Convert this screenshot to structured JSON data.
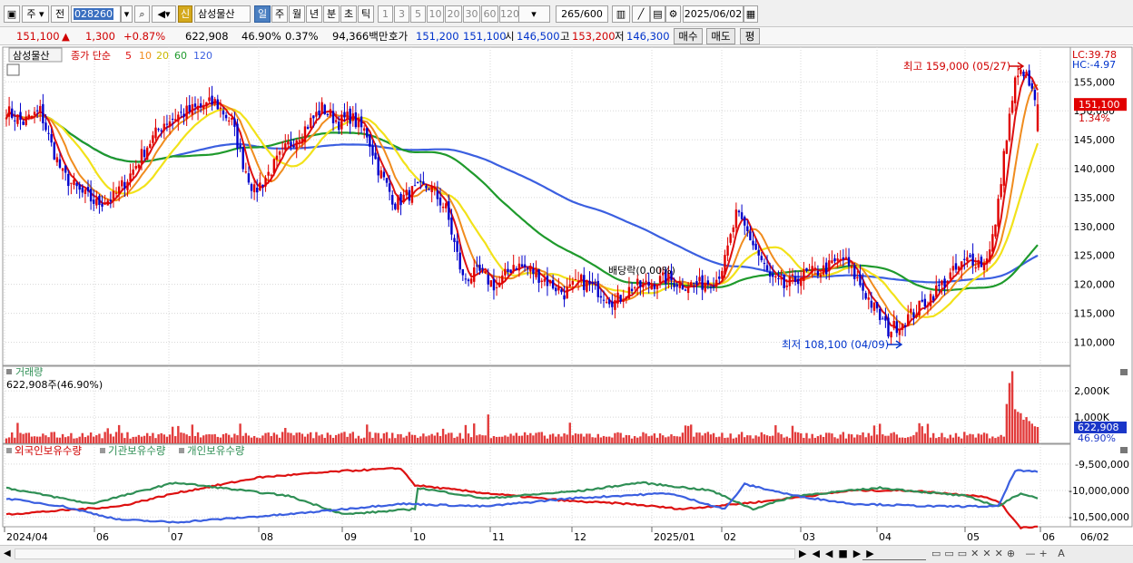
{
  "toolbar": {
    "mode_code": "주",
    "mode_all": "전",
    "code": "028260",
    "stock_badge": "신",
    "stock_name": "삼성물산",
    "periods": [
      "일",
      "주",
      "월",
      "년",
      "분",
      "초",
      "틱"
    ],
    "minutes": [
      "1",
      "3",
      "5",
      "10",
      "20",
      "30",
      "60",
      "120"
    ],
    "count": "265",
    "count_max": "/600",
    "date": "2025/06/02"
  },
  "quote": {
    "price": "151,100",
    "change": "1,300",
    "change_pct": "+0.87%",
    "volume": "622,908",
    "volume_ratio": "46.90%",
    "turnover": "0.37%",
    "amount": "94,366백만",
    "ask_label": "호가",
    "ask": "151,200",
    "bid": "151,100",
    "open_label": "시",
    "open": "146,500",
    "high_label": "고",
    "high": "153,200",
    "low_label": "저",
    "low": "146,300",
    "buy_label": "매수",
    "sell_label": "매도",
    "eval_label": "평"
  },
  "legend": {
    "name": "삼성물산",
    "ma_label": "종가 단순",
    "ma5": "5",
    "ma10": "10",
    "ma20": "20",
    "ma60": "60",
    "ma120": "120",
    "lc": "LC:39.78",
    "hc": "HC:-4.97",
    "price_tag": "151,100",
    "pct_tag": "1.34%",
    "high_note": "최고 159,000 (05/27)",
    "low_note": "최저 108,100 (04/09)",
    "div_note": "배당락(0.00%)",
    "vol_title": "거래량",
    "vol_value": "622,908주(46.90%)",
    "vol_tag": "622,908",
    "vol_pct": "46.90%",
    "hold_foreign": "외국인보유수량",
    "hold_inst": "기관보유수량",
    "hold_indiv": "개인보유수량"
  },
  "colors": {
    "up": "#e00000",
    "down": "#0000cc",
    "ma5": "#dd1111",
    "ma10": "#f08c1e",
    "ma20": "#f2e21a",
    "ma60": "#1f9a2c",
    "ma120": "#3b5fe0",
    "grid": "#d8d8d8",
    "volume": "#e23b3b"
  },
  "chart_data": [
    {
      "type": "candlestick",
      "title": "삼성물산 일봉",
      "xlabels": [
        "2024/04",
        "06",
        "07",
        "08",
        "09",
        "10",
        "11",
        "12",
        "2025/01",
        "02",
        "03",
        "04",
        "05",
        "06"
      ],
      "right_date": "06/02",
      "price_ticks": [
        "110,000",
        "115,000",
        "120,000",
        "125,000",
        "130,000",
        "135,000",
        "140,000",
        "145,000",
        "150,000",
        "155,000"
      ],
      "ylim": [
        106000,
        161000
      ],
      "anchors": [
        [
          0,
          150000
        ],
        [
          6,
          148000
        ],
        [
          12,
          150000
        ],
        [
          16,
          144000
        ],
        [
          20,
          139000
        ],
        [
          26,
          136000
        ],
        [
          32,
          134000
        ],
        [
          38,
          135000
        ],
        [
          44,
          139000
        ],
        [
          50,
          144000
        ],
        [
          56,
          148000
        ],
        [
          62,
          149500
        ],
        [
          68,
          150500
        ],
        [
          74,
          151500
        ],
        [
          80,
          148000
        ],
        [
          84,
          141000
        ],
        [
          88,
          136000
        ],
        [
          92,
          138500
        ],
        [
          100,
          144000
        ],
        [
          106,
          147000
        ],
        [
          112,
          150500
        ],
        [
          118,
          148000
        ],
        [
          122,
          149000
        ],
        [
          128,
          146000
        ],
        [
          132,
          140000
        ],
        [
          138,
          134000
        ],
        [
          144,
          136000
        ],
        [
          150,
          137000
        ],
        [
          156,
          133000
        ],
        [
          162,
          121000
        ],
        [
          168,
          122000
        ],
        [
          174,
          119500
        ],
        [
          180,
          123500
        ],
        [
          186,
          122500
        ],
        [
          192,
          120500
        ],
        [
          198,
          118500
        ],
        [
          204,
          120500
        ],
        [
          210,
          119000
        ],
        [
          216,
          117000
        ],
        [
          222,
          119500
        ],
        [
          228,
          120000
        ],
        [
          234,
          121000
        ],
        [
          240,
          120000
        ],
        [
          246,
          120000
        ],
        [
          252,
          121000
        ],
        [
          255,
          124000
        ],
        [
          259,
          132000
        ],
        [
          263,
          129000
        ],
        [
          266,
          126000
        ],
        [
          271,
          121000
        ],
        [
          276,
          119500
        ],
        [
          282,
          121500
        ],
        [
          290,
          122500
        ],
        [
          297,
          124500
        ],
        [
          303,
          120000
        ],
        [
          309,
          115000
        ],
        [
          313,
          112000
        ],
        [
          318,
          113500
        ],
        [
          324,
          116000
        ],
        [
          330,
          119000
        ],
        [
          336,
          122000
        ],
        [
          342,
          124500
        ],
        [
          347,
          123500
        ],
        [
          351,
          130000
        ],
        [
          355,
          146000
        ],
        [
          358,
          155000
        ],
        [
          361,
          157000
        ],
        [
          364,
          153000
        ],
        [
          366,
          151100
        ]
      ],
      "ma_series": [
        {
          "name": "5"
        },
        {
          "name": "10"
        },
        {
          "name": "20"
        },
        {
          "name": "60"
        },
        {
          "name": "120"
        }
      ]
    },
    {
      "type": "bar",
      "title": "거래량",
      "ylim": [
        0,
        2800000
      ],
      "ticks": [
        "1,000K",
        "2,000K"
      ]
    },
    {
      "type": "line",
      "title": "보유수량",
      "ticks": [
        "-9,500,000",
        "-10,000,000",
        "-10,500,000"
      ],
      "series": [
        {
          "name": "외국인보유수량"
        },
        {
          "name": "기관보유수량"
        },
        {
          "name": "개인보유수량"
        }
      ]
    }
  ]
}
